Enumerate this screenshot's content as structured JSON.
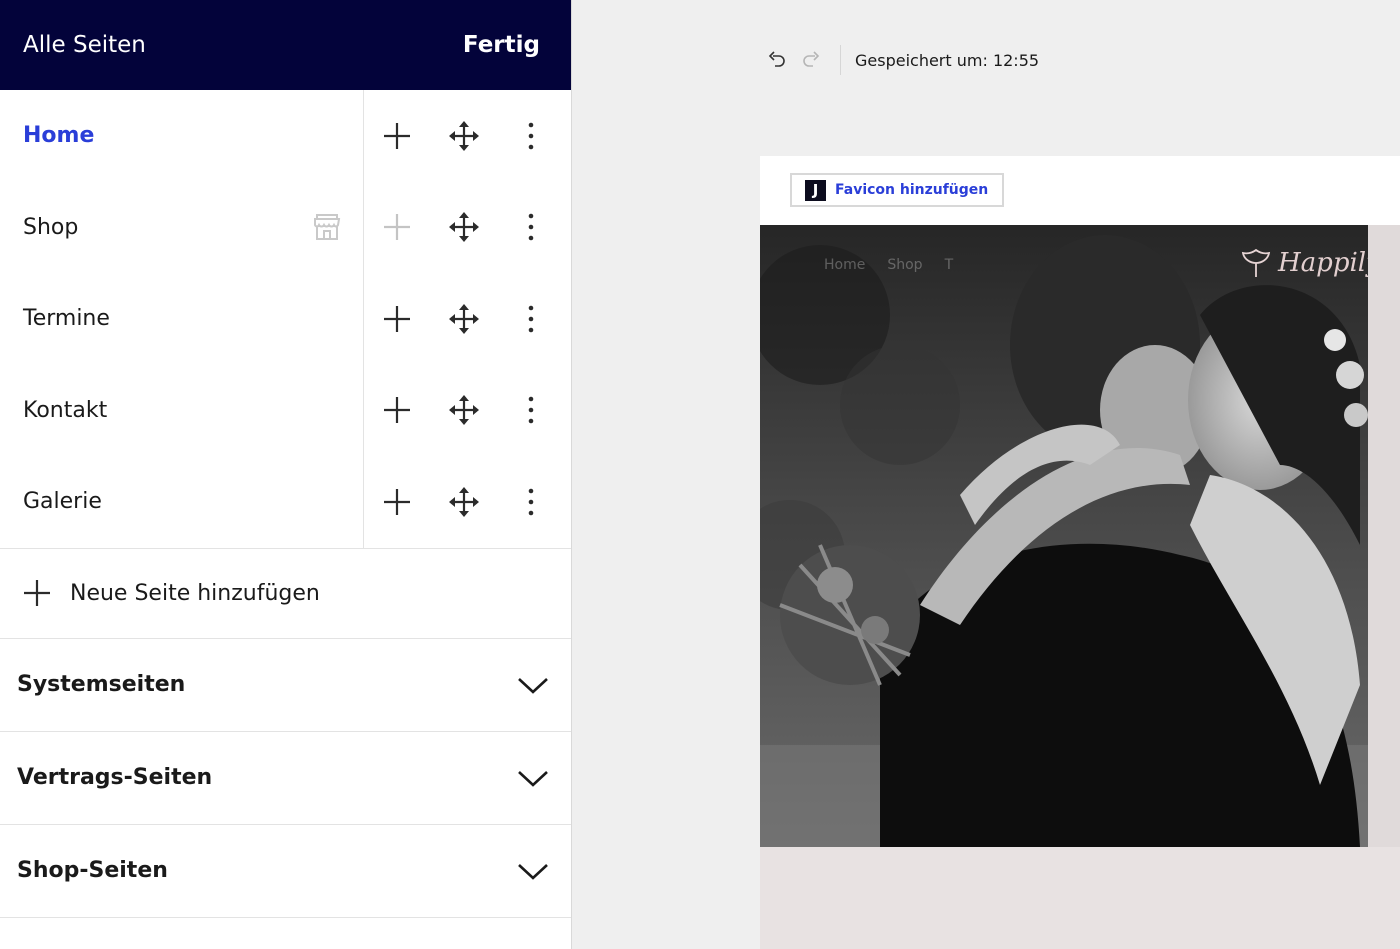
{
  "panel": {
    "title": "Alle Seiten",
    "done_label": "Fertig"
  },
  "pages": [
    {
      "label": "Home",
      "active": true
    },
    {
      "label": "Shop",
      "shop_icon": "store-icon"
    },
    {
      "label": "Termine"
    },
    {
      "label": "Kontakt"
    },
    {
      "label": "Galerie"
    }
  ],
  "add_page_label": "Neue Seite hinzufügen",
  "sections": [
    {
      "label": "Systemseiten"
    },
    {
      "label": "Vertrags-Seiten"
    },
    {
      "label": "Shop-Seiten"
    }
  ],
  "toolbar": {
    "saved_text": "Gespeichert um: 12:55",
    "undo_icon": "undo-icon",
    "redo_icon": "redo-icon"
  },
  "editor": {
    "favicon_logo": "J",
    "favicon_label": "Favicon hinzufügen",
    "site_nav": [
      "Home",
      "Shop",
      "T"
    ],
    "brand_text": "Happily Ev"
  },
  "colors": {
    "header_bg": "#03033a",
    "accent": "#2a3ed8"
  }
}
